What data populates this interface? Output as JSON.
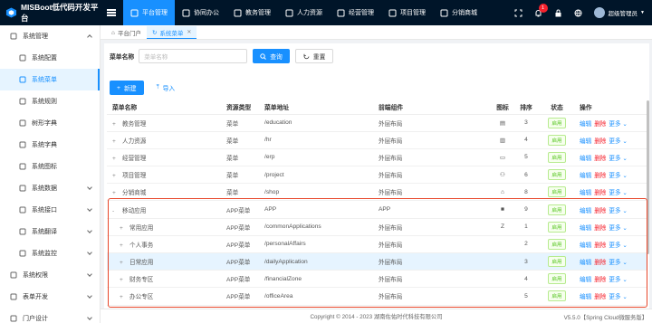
{
  "app": {
    "title": "MISBoot低代码开发平台"
  },
  "topnav": [
    {
      "label": "平台管理",
      "icon": "platform-icon",
      "active": true
    },
    {
      "label": "协同办公",
      "icon": "send-icon"
    },
    {
      "label": "教务管理",
      "icon": "grid-icon"
    },
    {
      "label": "人力资源",
      "icon": "people-icon"
    },
    {
      "label": "经营管理",
      "icon": "chart-icon"
    },
    {
      "label": "项目管理",
      "icon": "grid-icon"
    },
    {
      "label": "分销商城",
      "icon": "shop-icon"
    }
  ],
  "topright": {
    "notification_count": "1",
    "user_name": "超级管理员"
  },
  "sidebar": {
    "items": [
      {
        "label": "系统管理",
        "icon": "system-icon",
        "level": 0,
        "expanded": true
      },
      {
        "label": "系统配置",
        "icon": "document-icon",
        "level": 1
      },
      {
        "label": "系统菜单",
        "icon": "menu-icon",
        "level": 1,
        "active": true
      },
      {
        "label": "系统规则",
        "icon": "document-icon",
        "level": 1
      },
      {
        "label": "树形字典",
        "icon": "tree-icon",
        "level": 1
      },
      {
        "label": "系统字典",
        "icon": "v-icon",
        "level": 1
      },
      {
        "label": "系统图标",
        "icon": "settings-icon",
        "level": 1
      },
      {
        "label": "系统数据",
        "icon": "settings-icon",
        "level": 1,
        "collapsible": true
      },
      {
        "label": "系统接口",
        "icon": "settings-icon",
        "level": 1,
        "collapsible": true
      },
      {
        "label": "系统翻译",
        "icon": "settings-icon",
        "level": 1,
        "collapsible": true
      },
      {
        "label": "系统监控",
        "icon": "settings-icon",
        "level": 1,
        "collapsible": true
      },
      {
        "label": "系统权限",
        "icon": "settings-icon",
        "level": 0,
        "collapsible": true
      },
      {
        "label": "表单开发",
        "icon": "form-icon",
        "level": 0,
        "collapsible": true
      },
      {
        "label": "门户设计",
        "icon": "document-icon",
        "level": 0,
        "collapsible": true
      }
    ]
  },
  "tabs": [
    {
      "label": "平台门户",
      "icon": "home-icon"
    },
    {
      "label": "系统菜单",
      "icon": "refresh-icon",
      "active": true,
      "closable": true
    }
  ],
  "search": {
    "label": "菜单名称",
    "placeholder": "菜单名称",
    "query_label": "查询",
    "reset_label": "重置"
  },
  "toolbar": {
    "new_label": "新建",
    "import_label": "导入"
  },
  "table": {
    "headers": [
      "菜单名称",
      "资源类型",
      "菜单地址",
      "前端组件",
      "图标",
      "排序",
      "状态",
      "操作"
    ],
    "status_enabled": "启用",
    "ops": {
      "edit": "编辑",
      "delete": "删除",
      "more": "更多"
    },
    "rows": [
      {
        "name": "教务管理",
        "type": "菜单",
        "url": "/education",
        "component": "外层布局",
        "icon": "book-icon",
        "glyph": "▤",
        "sort": "3",
        "level": 0,
        "expand": "+"
      },
      {
        "name": "人力资源",
        "type": "菜单",
        "url": "/hr",
        "component": "外层布局",
        "icon": "card-icon",
        "glyph": "▥",
        "sort": "4",
        "level": 0,
        "expand": "+"
      },
      {
        "name": "经营管理",
        "type": "菜单",
        "url": "/erp",
        "component": "外层布局",
        "icon": "monitor-icon",
        "glyph": "▭",
        "sort": "5",
        "level": 0,
        "expand": "+"
      },
      {
        "name": "项目管理",
        "type": "菜单",
        "url": "/project",
        "component": "外层布局",
        "icon": "team-icon",
        "glyph": "⚇",
        "sort": "6",
        "level": 0,
        "expand": "+"
      },
      {
        "name": "分销商城",
        "type": "菜单",
        "url": "/shop",
        "component": "外层布局",
        "icon": "bag-icon",
        "glyph": "⌂",
        "sort": "8",
        "level": 0,
        "expand": "+"
      },
      {
        "name": "移动应用",
        "type": "APP菜单",
        "url": "APP",
        "component": "APP",
        "icon": "apps-icon",
        "glyph": "■",
        "sort": "9",
        "level": 0,
        "expand": "-"
      },
      {
        "name": "常用应用",
        "type": "APP菜单",
        "url": "/commonApplications",
        "component": "外层布局",
        "icon": "z-icon",
        "glyph": "Z",
        "sort": "1",
        "level": 1,
        "expand": "+"
      },
      {
        "name": "个人事务",
        "type": "APP菜单",
        "url": "/personalAffairs",
        "component": "外层布局",
        "icon": "",
        "glyph": "",
        "sort": "2",
        "level": 1,
        "expand": "+"
      },
      {
        "name": "日常应用",
        "type": "APP菜单",
        "url": "/dailyApplication",
        "component": "外层布局",
        "icon": "",
        "glyph": "",
        "sort": "3",
        "level": 1,
        "expand": "+",
        "highlight": true
      },
      {
        "name": "财务专区",
        "type": "APP菜单",
        "url": "/financialZone",
        "component": "外层布局",
        "icon": "",
        "glyph": "",
        "sort": "4",
        "level": 1,
        "expand": "+"
      },
      {
        "name": "办公专区",
        "type": "APP菜单",
        "url": "/officeArea",
        "component": "外层布局",
        "icon": "",
        "glyph": "",
        "sort": "5",
        "level": 1,
        "expand": "+"
      }
    ]
  },
  "footer": {
    "copyright": "Copyright © 2014 - 2023 湖南佐佑时代科技有限公司",
    "version": "V5.5.0【Spring Cloud微服务版】"
  },
  "colors": {
    "topbar": "#001529",
    "accent": "#1890ff",
    "danger": "#f5222d",
    "success": "#52c41a",
    "highlight_box": "#e8462a"
  }
}
